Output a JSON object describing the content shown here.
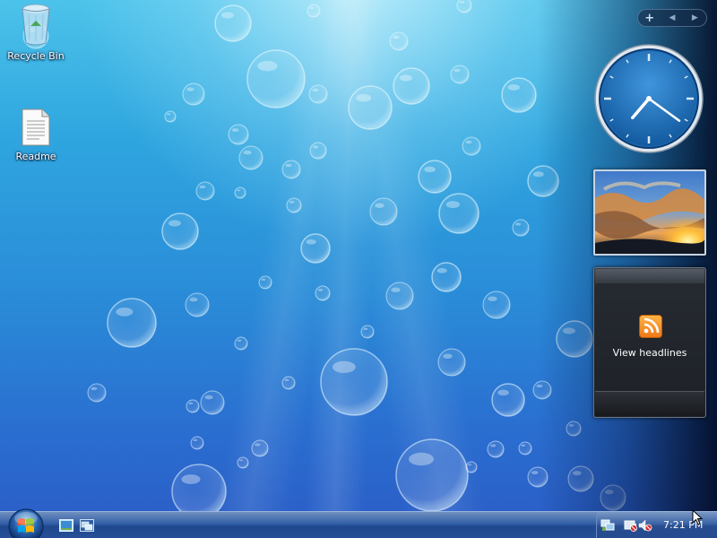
{
  "desktop": {
    "icons": [
      {
        "label": "Recycle Bin",
        "icon": "recycle-bin-icon"
      },
      {
        "label": "Readme",
        "icon": "text-document-icon"
      }
    ]
  },
  "sidebar": {
    "toolbar": {
      "add_label": "+",
      "prev_label": "◀",
      "next_label": "▶"
    },
    "clock": {
      "hour": 7,
      "minute": 21,
      "face_color": "#1e6bb8"
    },
    "slideshow": {
      "content": "sunset-clouds-photo"
    },
    "feed": {
      "label": "View headlines",
      "icon": "rss-feed-icon",
      "accent": "#f07818"
    }
  },
  "taskbar": {
    "start_icon": "windows-start-orb",
    "quick_launch": [
      "show-desktop-icon",
      "switch-windows-icon"
    ],
    "tray_icons": [
      "network-icon",
      "power-icon",
      "volume-muted-icon"
    ],
    "clock": "7:21 PM"
  }
}
